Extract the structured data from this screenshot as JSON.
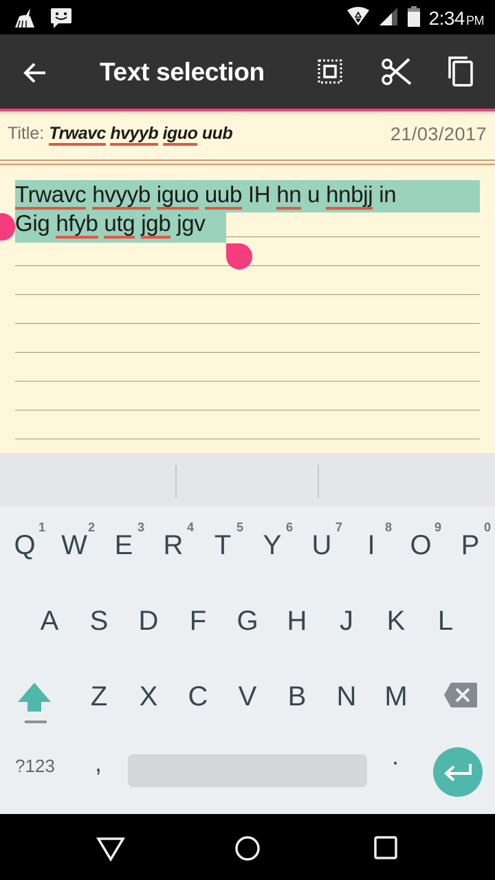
{
  "status_bar": {
    "time": "2:34",
    "ampm": "PM",
    "icons": [
      "cleaner-icon",
      "messaging-icon",
      "wifi-icon",
      "signal-icon",
      "battery-icon"
    ]
  },
  "action_bar": {
    "title": "Text selection",
    "back_icon": "arrow-left-icon",
    "actions": [
      {
        "name": "select-all",
        "icon": "select-all-icon"
      },
      {
        "name": "cut",
        "icon": "scissors-icon"
      },
      {
        "name": "copy",
        "icon": "copy-icon"
      }
    ],
    "accent_color": "#f4417a"
  },
  "note": {
    "title_label": "Title:",
    "title_words": [
      "Trwavc",
      "hvyyb",
      "iguo",
      "uub"
    ],
    "date": "21/03/2017",
    "line1_words": [
      {
        "w": "Trwavc",
        "typo": true
      },
      {
        "w": "hvyyb",
        "typo": true
      },
      {
        "w": "iguo",
        "typo": true
      },
      {
        "w": "uub",
        "typo": true
      },
      {
        "w": "IH",
        "typo": false
      },
      {
        "w": "hn",
        "typo": true
      },
      {
        "w": "u",
        "typo": false
      },
      {
        "w": "hnbjj",
        "typo": true
      },
      {
        "w": "in",
        "typo": false
      }
    ],
    "line2_words": [
      {
        "w": "Gig",
        "typo": false
      },
      {
        "w": "hfyb",
        "typo": true
      },
      {
        "w": "utg",
        "typo": true
      },
      {
        "w": "jgb",
        "typo": true
      },
      {
        "w": "jgv",
        "typo": false
      }
    ],
    "selection_color": "#9ad2bb",
    "paper_color": "#fef7dc"
  },
  "keyboard": {
    "row1": [
      {
        "k": "Q",
        "h": "1"
      },
      {
        "k": "W",
        "h": "2"
      },
      {
        "k": "E",
        "h": "3"
      },
      {
        "k": "R",
        "h": "4"
      },
      {
        "k": "T",
        "h": "5"
      },
      {
        "k": "Y",
        "h": "6"
      },
      {
        "k": "U",
        "h": "7"
      },
      {
        "k": "I",
        "h": "8"
      },
      {
        "k": "O",
        "h": "9"
      },
      {
        "k": "P",
        "h": "0"
      }
    ],
    "row2": [
      "A",
      "S",
      "D",
      "F",
      "G",
      "H",
      "J",
      "K",
      "L"
    ],
    "row3": [
      "Z",
      "X",
      "C",
      "V",
      "B",
      "N",
      "M"
    ],
    "symbols_label": "?123",
    "comma": ",",
    "period": ".",
    "shift_icon": "shift-icon",
    "delete_icon": "backspace-icon",
    "enter_icon": "enter-icon",
    "accent_color": "#4fb8ab"
  },
  "nav_bar": {
    "buttons": [
      "back-triangle-icon",
      "home-circle-icon",
      "recents-square-icon"
    ]
  }
}
